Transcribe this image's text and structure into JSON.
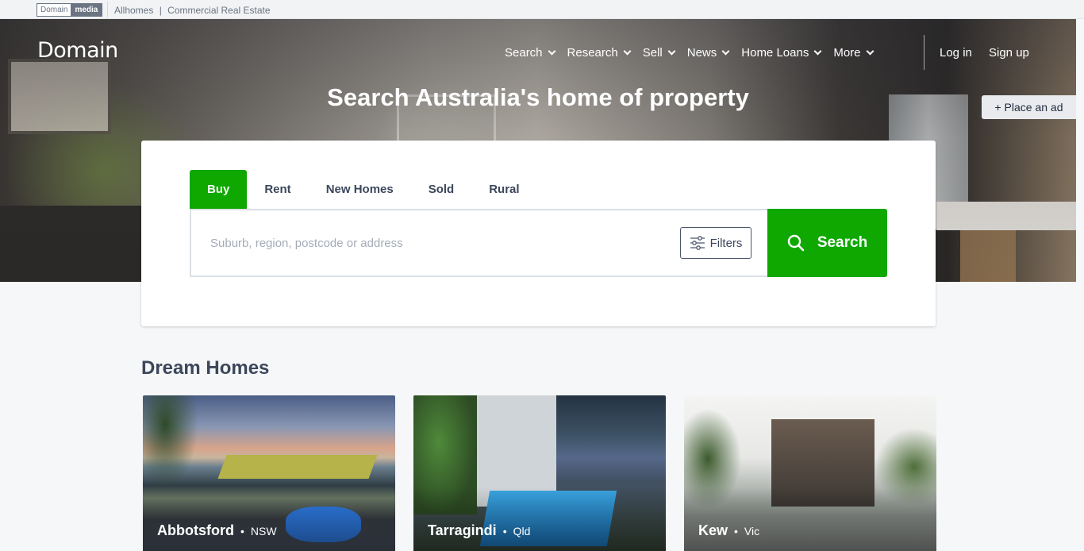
{
  "topbar": {
    "brand_part1": "Domain",
    "brand_part2": "media",
    "link1": "Allhomes",
    "separator": "|",
    "link2": "Commercial Real Estate"
  },
  "header": {
    "logo": "Domain",
    "nav": [
      {
        "label": "Search"
      },
      {
        "label": "Research"
      },
      {
        "label": "Sell"
      },
      {
        "label": "News"
      },
      {
        "label": "Home Loans"
      },
      {
        "label": "More"
      }
    ],
    "login": "Log in",
    "signup": "Sign up",
    "place_ad": "+ Place an ad"
  },
  "hero": {
    "headline": "Search Australia's home of property"
  },
  "search": {
    "tabs": [
      {
        "label": "Buy",
        "active": true
      },
      {
        "label": "Rent",
        "active": false
      },
      {
        "label": "New Homes",
        "active": false
      },
      {
        "label": "Sold",
        "active": false
      },
      {
        "label": "Rural",
        "active": false
      }
    ],
    "placeholder": "Suburb, region, postcode or address",
    "value": "",
    "filters_label": "Filters",
    "button_label": "Search"
  },
  "dream_homes": {
    "title": "Dream Homes",
    "items": [
      {
        "suburb": "Abbotsford",
        "state": "NSW"
      },
      {
        "suburb": "Tarragindi",
        "state": "Qld"
      },
      {
        "suburb": "Kew",
        "state": "Vic"
      }
    ]
  },
  "colors": {
    "brand_green": "#0ea800",
    "text": "#3c475b"
  }
}
